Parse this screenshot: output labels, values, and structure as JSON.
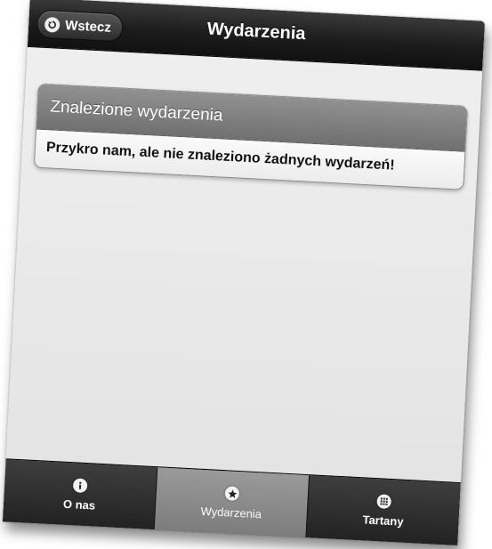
{
  "header": {
    "title": "Wydarzenia",
    "back_label": "Wstecz"
  },
  "panel": {
    "title": "Znalezione wydarzenia",
    "message": "Przykro nam, ale nie znaleziono żadnych wydarzeń!"
  },
  "tabbar": {
    "tabs": [
      {
        "label": "O nas",
        "icon": "info-icon",
        "active": false
      },
      {
        "label": "Wydarzenia",
        "icon": "star-icon",
        "active": true
      },
      {
        "label": "Tartany",
        "icon": "grid-icon",
        "active": false
      }
    ]
  },
  "colors": {
    "header_bg": "#1c1c1c",
    "panel_header_bg": "#7c7c7c",
    "active_tab_bg": "#8c8c8c",
    "content_bg": "#e8e8e8"
  }
}
